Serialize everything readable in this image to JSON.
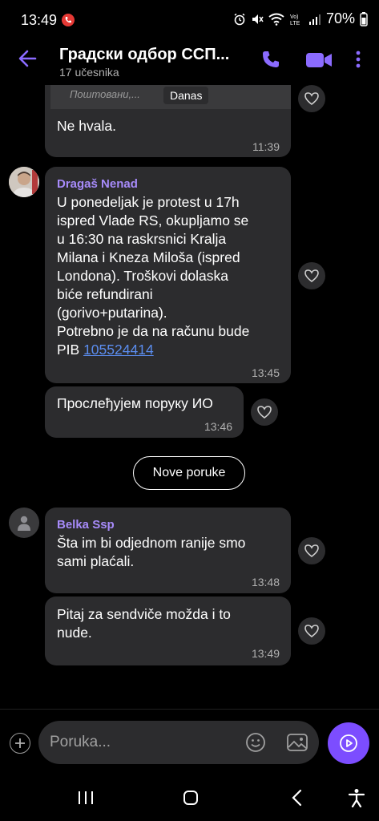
{
  "status_bar": {
    "time": "13:49",
    "battery": "70%"
  },
  "header": {
    "title": "Градски одбор ССП...",
    "subtitle": "17 učesnika"
  },
  "date_chip": "Danas",
  "quoted_preview": "Поштовани,...",
  "messages": [
    {
      "text": "Ne hvala.",
      "time": "11:39"
    },
    {
      "sender": "Dragaš Nenad",
      "text": "U ponedeljak je protest u 17h\nispred Vlade RS, okupljamo se\nu 16:30 na raskrsnici Kralja\nMilana i Kneza Miloša (ispred\nLondona). Troškovi dolaska\nbiće refundirani\n(gorivo+putarina).\nPotrebno je da na računu bude\nPIB ",
      "link": "105524414",
      "time": "13:45"
    },
    {
      "text": "Прослеђујем поруку ИО",
      "time": "13:46"
    },
    {
      "sender": "Belka Ssp",
      "text": "Šta im bi odjednom ranije smo\nsami plaćali.",
      "time": "13:48"
    },
    {
      "text": "Pitaj za sendviče možda i to\nnude.",
      "time": "13:49"
    }
  ],
  "new_messages_button": "Nove poruke",
  "composer": {
    "placeholder": "Poruka..."
  },
  "colors": {
    "accent": "#7c4dff",
    "sender": "#a78bfa",
    "bubble": "#2c2c2e",
    "link": "#5b8def"
  },
  "icons": [
    "back-arrow-icon",
    "phone-icon",
    "video-icon",
    "more-icon",
    "heart-icon",
    "plus-icon",
    "emoji-icon",
    "gallery-icon",
    "send-icon",
    "recents-icon",
    "home-icon",
    "back-icon",
    "accessibility-icon"
  ]
}
